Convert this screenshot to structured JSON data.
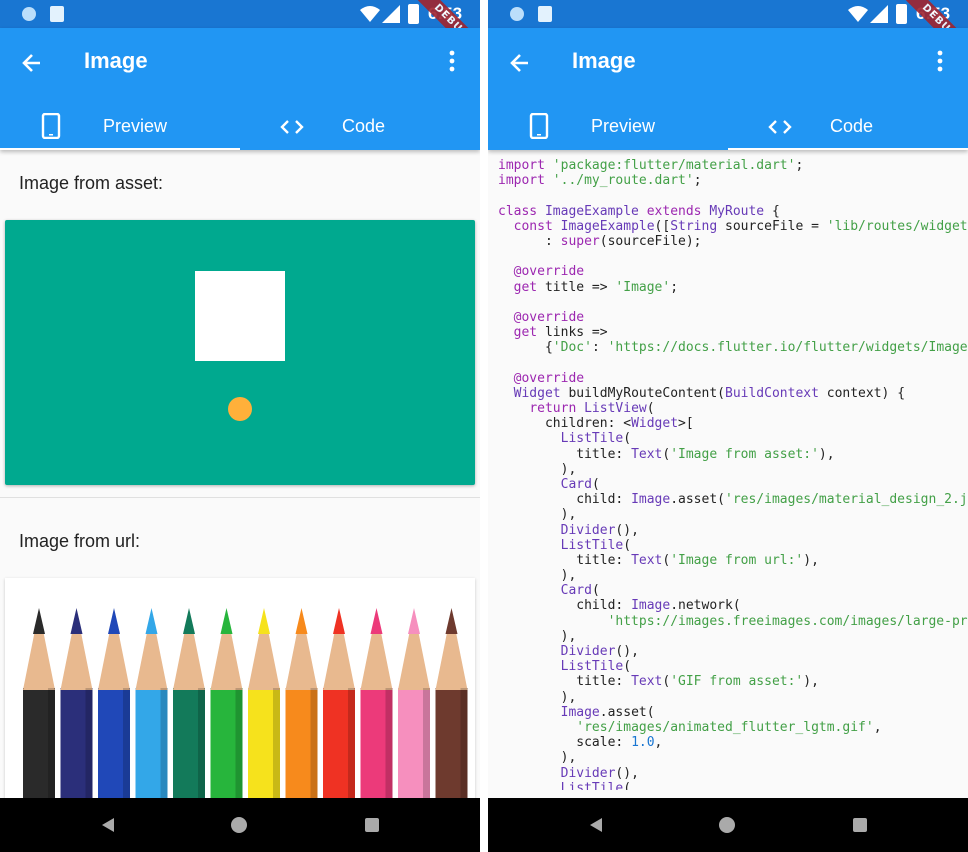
{
  "status_bar": {
    "time": "6:53",
    "debug_banner": "DEBUG"
  },
  "app_bar": {
    "title": "Image"
  },
  "tabs": [
    {
      "label": "Preview",
      "icon": "smartphone-icon"
    },
    {
      "label": "Code",
      "icon": "code-icon"
    }
  ],
  "preview": {
    "asset_title": "Image from asset:",
    "url_title": "Image from url:",
    "colors": {
      "asset_bg": "#00a98f",
      "asset_square": "#ffffff",
      "asset_dot": "#ffb03a"
    },
    "pencil_colors": [
      "#2a2a2a",
      "#2b2f7a",
      "#2048b8",
      "#33a7e8",
      "#137a5a",
      "#27b53c",
      "#f6e21c",
      "#f78a1c",
      "#ef3223",
      "#ec3a7a",
      "#f68fbe",
      "#6e3a2e"
    ]
  },
  "code": {
    "lines": [
      [
        [
          "kw",
          "import "
        ],
        [
          "str",
          "'package:flutter/material.dart'"
        ],
        [
          "p",
          ";"
        ]
      ],
      [
        [
          "kw",
          "import "
        ],
        [
          "str",
          "'../my_route.dart'"
        ],
        [
          "p",
          ";"
        ]
      ],
      [],
      [
        [
          "kw",
          "class "
        ],
        [
          "ty",
          "ImageExample "
        ],
        [
          "kw",
          "extends "
        ],
        [
          "ty",
          "MyRoute"
        ],
        [
          "p",
          " {"
        ]
      ],
      [
        [
          "p",
          "  "
        ],
        [
          "kw",
          "const "
        ],
        [
          "ty",
          "ImageExample"
        ],
        [
          "p",
          "(["
        ],
        [
          "ty",
          "String"
        ],
        [
          "p",
          " sourceFile = "
        ],
        [
          "str",
          "'lib/routes/widget"
        ]
      ],
      [
        [
          "p",
          "      : "
        ],
        [
          "kw",
          "super"
        ],
        [
          "p",
          "(sourceFile);"
        ]
      ],
      [],
      [
        [
          "p",
          "  "
        ],
        [
          "kw",
          "@override"
        ]
      ],
      [
        [
          "p",
          "  "
        ],
        [
          "kw",
          "get"
        ],
        [
          "p",
          " title => "
        ],
        [
          "str",
          "'Image'"
        ],
        [
          "p",
          ";"
        ]
      ],
      [],
      [
        [
          "p",
          "  "
        ],
        [
          "kw",
          "@override"
        ]
      ],
      [
        [
          "p",
          "  "
        ],
        [
          "kw",
          "get"
        ],
        [
          "p",
          " links =>"
        ]
      ],
      [
        [
          "p",
          "      {"
        ],
        [
          "str",
          "'Doc'"
        ],
        [
          "p",
          ": "
        ],
        [
          "str",
          "'https://docs.flutter.io/flutter/widgets/Image"
        ]
      ],
      [],
      [
        [
          "p",
          "  "
        ],
        [
          "kw",
          "@override"
        ]
      ],
      [
        [
          "p",
          "  "
        ],
        [
          "ty",
          "Widget"
        ],
        [
          "p",
          " buildMyRouteContent("
        ],
        [
          "ty",
          "BuildContext"
        ],
        [
          "p",
          " context) {"
        ]
      ],
      [
        [
          "p",
          "    "
        ],
        [
          "kw",
          "return "
        ],
        [
          "ty",
          "ListView"
        ],
        [
          "p",
          "("
        ]
      ],
      [
        [
          "p",
          "      children: <"
        ],
        [
          "ty",
          "Widget"
        ],
        [
          "p",
          ">["
        ]
      ],
      [
        [
          "p",
          "        "
        ],
        [
          "ty",
          "ListTile"
        ],
        [
          "p",
          "("
        ]
      ],
      [
        [
          "p",
          "          title: "
        ],
        [
          "ty",
          "Text"
        ],
        [
          "p",
          "("
        ],
        [
          "str",
          "'Image from asset:'"
        ],
        [
          "p",
          "),"
        ]
      ],
      [
        [
          "p",
          "        ),"
        ]
      ],
      [
        [
          "p",
          "        "
        ],
        [
          "ty",
          "Card"
        ],
        [
          "p",
          "("
        ]
      ],
      [
        [
          "p",
          "          child: "
        ],
        [
          "ty",
          "Image"
        ],
        [
          "p",
          ".asset("
        ],
        [
          "str",
          "'res/images/material_design_2.j"
        ]
      ],
      [
        [
          "p",
          "        ),"
        ]
      ],
      [
        [
          "p",
          "        "
        ],
        [
          "ty",
          "Divider"
        ],
        [
          "p",
          "(),"
        ]
      ],
      [
        [
          "p",
          "        "
        ],
        [
          "ty",
          "ListTile"
        ],
        [
          "p",
          "("
        ]
      ],
      [
        [
          "p",
          "          title: "
        ],
        [
          "ty",
          "Text"
        ],
        [
          "p",
          "("
        ],
        [
          "str",
          "'Image from url:'"
        ],
        [
          "p",
          "),"
        ]
      ],
      [
        [
          "p",
          "        ),"
        ]
      ],
      [
        [
          "p",
          "        "
        ],
        [
          "ty",
          "Card"
        ],
        [
          "p",
          "("
        ]
      ],
      [
        [
          "p",
          "          child: "
        ],
        [
          "ty",
          "Image"
        ],
        [
          "p",
          ".network("
        ]
      ],
      [
        [
          "p",
          "              "
        ],
        [
          "str",
          "'https://images.freeimages.com/images/large-pr"
        ]
      ],
      [
        [
          "p",
          "        ),"
        ]
      ],
      [
        [
          "p",
          "        "
        ],
        [
          "ty",
          "Divider"
        ],
        [
          "p",
          "(),"
        ]
      ],
      [
        [
          "p",
          "        "
        ],
        [
          "ty",
          "ListTile"
        ],
        [
          "p",
          "("
        ]
      ],
      [
        [
          "p",
          "          title: "
        ],
        [
          "ty",
          "Text"
        ],
        [
          "p",
          "("
        ],
        [
          "str",
          "'GIF from asset:'"
        ],
        [
          "p",
          "),"
        ]
      ],
      [
        [
          "p",
          "        ),"
        ]
      ],
      [
        [
          "p",
          "        "
        ],
        [
          "ty",
          "Image"
        ],
        [
          "p",
          ".asset("
        ]
      ],
      [
        [
          "p",
          "          "
        ],
        [
          "str",
          "'res/images/animated_flutter_lgtm.gif'"
        ],
        [
          "p",
          ","
        ]
      ],
      [
        [
          "p",
          "          scale: "
        ],
        [
          "num",
          "1.0"
        ],
        [
          "p",
          ","
        ]
      ],
      [
        [
          "p",
          "        ),"
        ]
      ],
      [
        [
          "p",
          "        "
        ],
        [
          "ty",
          "Divider"
        ],
        [
          "p",
          "(),"
        ]
      ],
      [
        [
          "p",
          "        "
        ],
        [
          "ty",
          "ListTile"
        ],
        [
          "p",
          "("
        ]
      ]
    ]
  },
  "colors": {
    "primary": "#2196f3",
    "primary_dark": "#1976d2",
    "debug": "#a1242f"
  }
}
